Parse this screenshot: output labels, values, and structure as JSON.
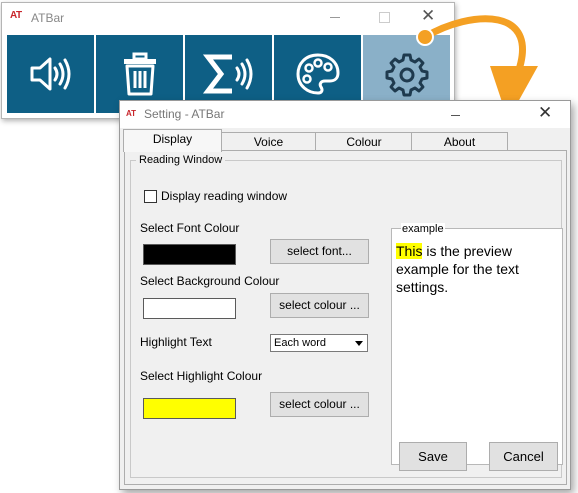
{
  "main_window": {
    "title": "ATBar",
    "app_icon": "AT",
    "tools": [
      {
        "name": "speak",
        "icon": "speaker-waves-icon"
      },
      {
        "name": "remove",
        "icon": "trash-icon"
      },
      {
        "name": "math",
        "icon": "sigma-speech-icon"
      },
      {
        "name": "colour",
        "icon": "palette-icon"
      },
      {
        "name": "settings",
        "icon": "gear-icon",
        "active": true
      }
    ],
    "toolbar_color": "#0e5f85",
    "active_tool_color": "#8ab0c8"
  },
  "annotation_arrow_color": "#f4a023",
  "dialog": {
    "title": "Setting - ATBar",
    "app_icon": "AT",
    "tabs": [
      "Display",
      "Voice",
      "Colour",
      "About"
    ],
    "selected_tab": "Display",
    "group_label": "Reading Window",
    "display_reading_window_label": "Display reading window",
    "display_reading_window_checked": false,
    "font_colour_label": "Select Font Colour",
    "font_colour": "#000000",
    "select_font_button": "select font...",
    "background_colour_label": "Select Background Colour",
    "background_colour": "#ffffff",
    "select_colour_button": "select colour ...",
    "highlight_text_label": "Highlight Text",
    "highlight_option": "Each word",
    "highlight_colour_label": "Select Highlight Colour",
    "highlight_colour": "#ffff00",
    "select_highlight_colour_button": "select colour ...",
    "example_label": "example",
    "example_highlight": "This",
    "example_rest": " is the preview example for the text settings.",
    "save_button": "Save",
    "cancel_button": "Cancel"
  }
}
